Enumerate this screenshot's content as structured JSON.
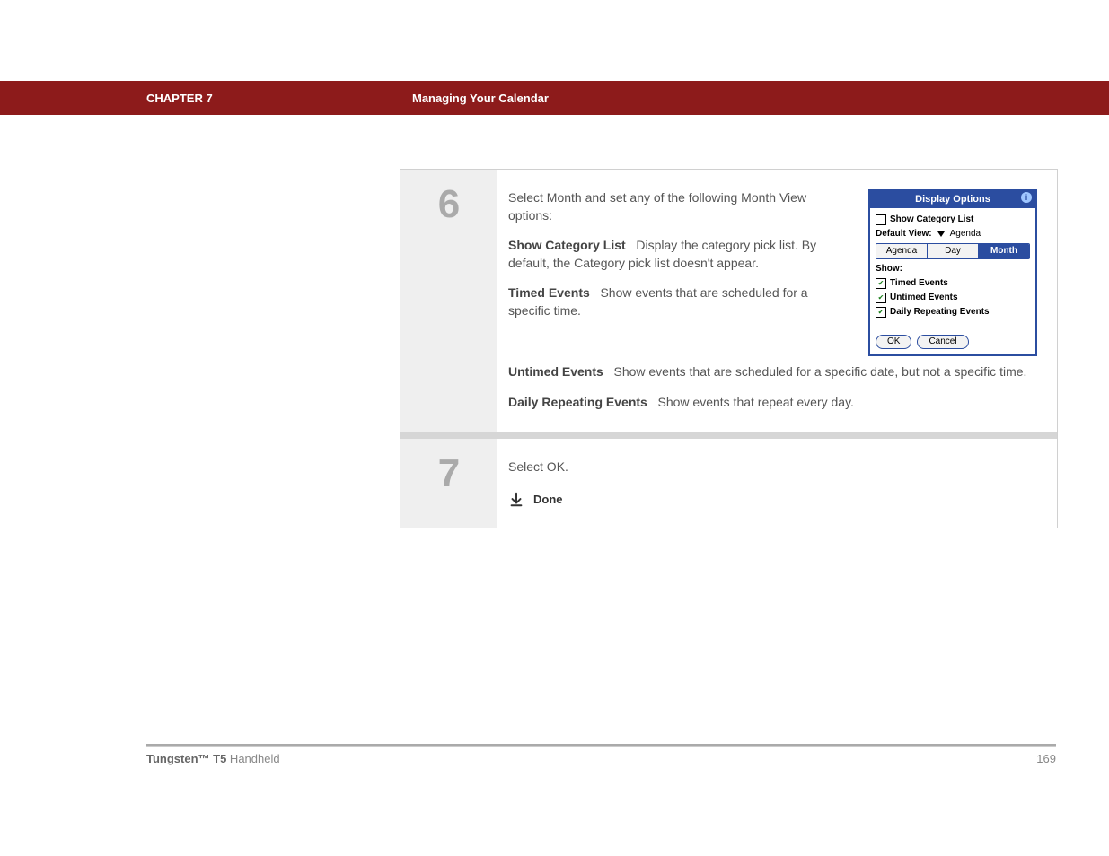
{
  "header": {
    "chapter_label": "CHAPTER 7",
    "title": "Managing Your Calendar"
  },
  "steps": [
    {
      "num": "6",
      "intro": "Select Month and set any of the following Month View options:",
      "options": [
        {
          "term": "Show Category List",
          "desc": "Display the category pick list. By default, the Category pick list doesn't appear."
        },
        {
          "term": "Timed Events",
          "desc": "Show events that are scheduled for a specific time."
        },
        {
          "term": "Untimed Events",
          "desc": "Show events that are scheduled for a specific date, but not a specific time."
        },
        {
          "term": "Daily Repeating Events",
          "desc": "Show events that repeat every day."
        }
      ]
    },
    {
      "num": "7",
      "text": "Select OK.",
      "done_label": "Done"
    }
  ],
  "dialog": {
    "title": "Display Options",
    "show_category_label": "Show Category List",
    "default_view_label": "Default View:",
    "default_view_value": "Agenda",
    "tabs": [
      "Agenda",
      "Day",
      "Month"
    ],
    "active_tab": "Month",
    "show_label": "Show:",
    "items": [
      {
        "label": "Timed Events",
        "checked": true
      },
      {
        "label": "Untimed Events",
        "checked": true
      },
      {
        "label": "Daily Repeating Events",
        "checked": true
      }
    ],
    "ok": "OK",
    "cancel": "Cancel"
  },
  "footer": {
    "product_bold": "Tungsten™ T5",
    "product_rest": " Handheld",
    "page": "169"
  }
}
